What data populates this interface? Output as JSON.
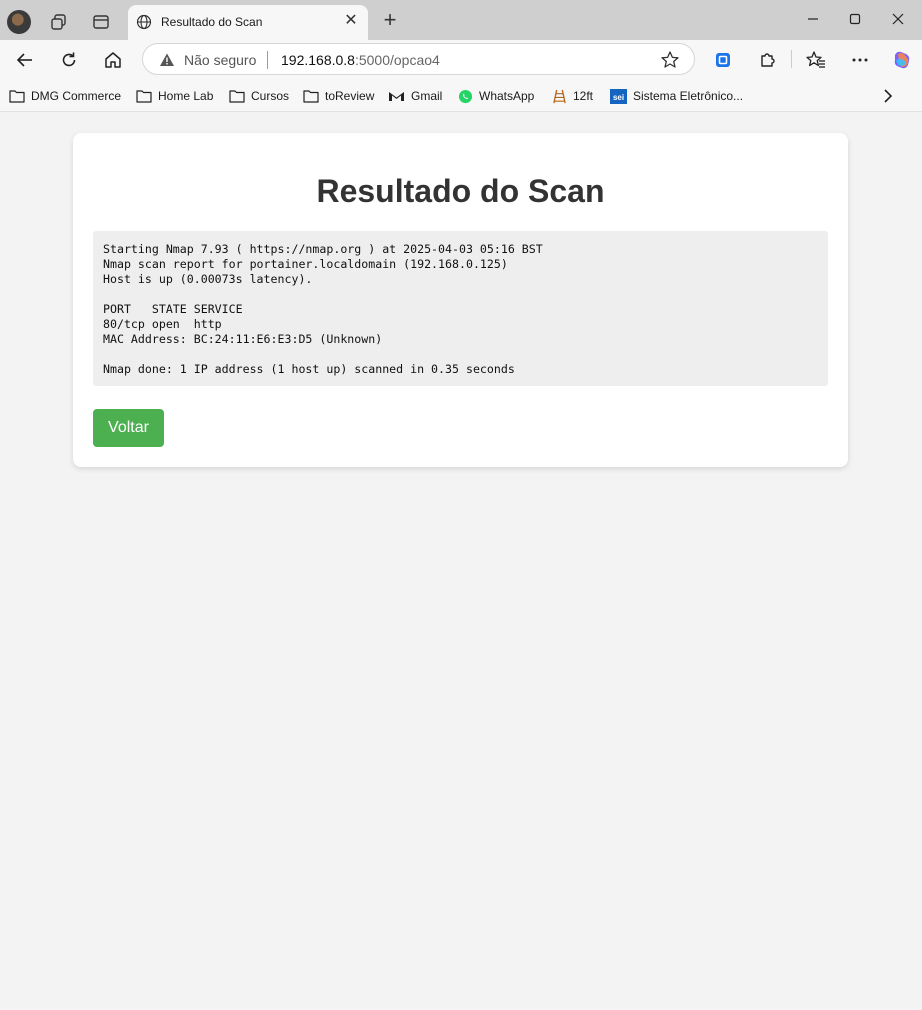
{
  "browser": {
    "tab": {
      "title": "Resultado do Scan"
    },
    "address_bar": {
      "security_label": "Não seguro",
      "url_host": "192.168.0.8",
      "url_rest": ":5000/opcao4"
    },
    "bookmarks": [
      {
        "label": "DMG Commerce",
        "icon": "folder-icon"
      },
      {
        "label": "Home Lab",
        "icon": "folder-icon"
      },
      {
        "label": "Cursos",
        "icon": "folder-icon"
      },
      {
        "label": "toReview",
        "icon": "folder-icon"
      },
      {
        "label": "Gmail",
        "icon": "gmail-icon"
      },
      {
        "label": "WhatsApp",
        "icon": "whatsapp-icon"
      },
      {
        "label": "12ft",
        "icon": "ladder-icon"
      },
      {
        "label": "Sistema Eletrônico...",
        "icon": "sei-icon"
      }
    ]
  },
  "page": {
    "title": "Resultado do Scan",
    "scan_output": "Starting Nmap 7.93 ( https://nmap.org ) at 2025-04-03 05:16 BST\nNmap scan report for portainer.localdomain (192.168.0.125)\nHost is up (0.00073s latency).\n\nPORT   STATE SERVICE\n80/tcp open  http\nMAC Address: BC:24:11:E6:E3:D5 (Unknown)\n\nNmap done: 1 IP address (1 host up) scanned in 0.35 seconds",
    "back_button": "Voltar"
  },
  "colors": {
    "button": "#4caf50",
    "output_bg": "#eeeeee",
    "page_bg": "#f3f3f3"
  }
}
